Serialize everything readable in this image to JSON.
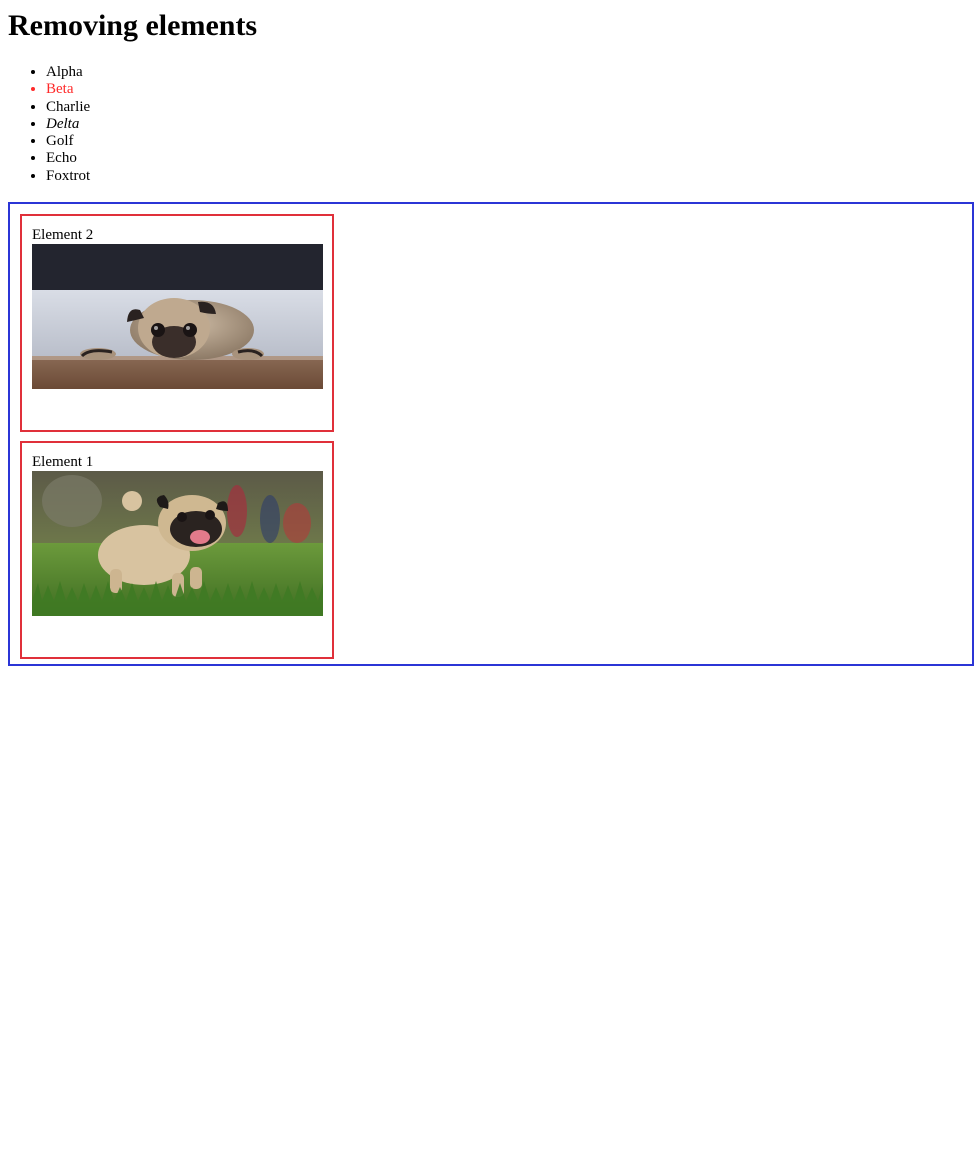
{
  "page": {
    "heading": "Removing elements"
  },
  "list": {
    "items": [
      {
        "label": "Alpha"
      },
      {
        "label": "Beta",
        "color": "#ff2a2a"
      },
      {
        "label": "Charlie"
      },
      {
        "label": "Delta",
        "style": "italic"
      },
      {
        "label": "Golf"
      },
      {
        "label": "Echo"
      },
      {
        "label": "Foxtrot"
      }
    ]
  },
  "container": {
    "border_color": "#2b35d6",
    "elements": [
      {
        "label": "Element 2",
        "image": "pug-lying-on-floor",
        "border_color": "#e0303a"
      },
      {
        "label": "Element 1",
        "image": "pug-running-on-grass",
        "border_color": "#e0303a"
      }
    ]
  }
}
